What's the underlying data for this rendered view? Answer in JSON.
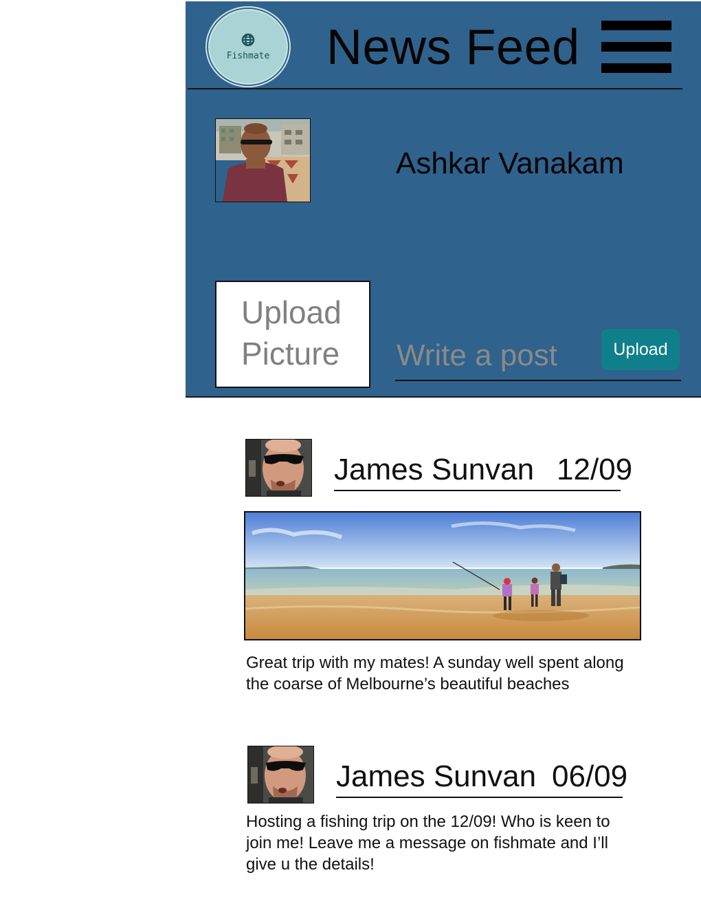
{
  "app": {
    "logo_text": "Fishmate",
    "logo_icon": "globe-icon",
    "title": "News Feed",
    "menu_icon": "hamburger-menu-icon"
  },
  "profile": {
    "name": "Ashkar Vanakam",
    "avatar": "profile-photo"
  },
  "composer": {
    "upload_picture_line1": "Upload",
    "upload_picture_line2": "Picture",
    "post_placeholder": "Write a post",
    "upload_label": "Upload"
  },
  "posts": [
    {
      "author": "James Sunvan",
      "date": "12/09",
      "avatar": "author-photo",
      "image": "beach-fishing-photo",
      "text_line1": "Great trip with my mates! A sunday well spent along",
      "text_line2": "the coarse of Melbourne’s beautiful beaches"
    },
    {
      "author": "James Sunvan",
      "date": "06/09",
      "avatar": "author-photo",
      "text_line1": "Hosting a fishing trip on the 12/09! Who is keen to",
      "text_line2": "join me! Leave me a message on fishmate and I’ll",
      "text_line3": "give u the details!"
    }
  ],
  "colors": {
    "panel": "#2f628c",
    "upload_button": "#0f7f8c",
    "logo": "#a9d3d4"
  }
}
